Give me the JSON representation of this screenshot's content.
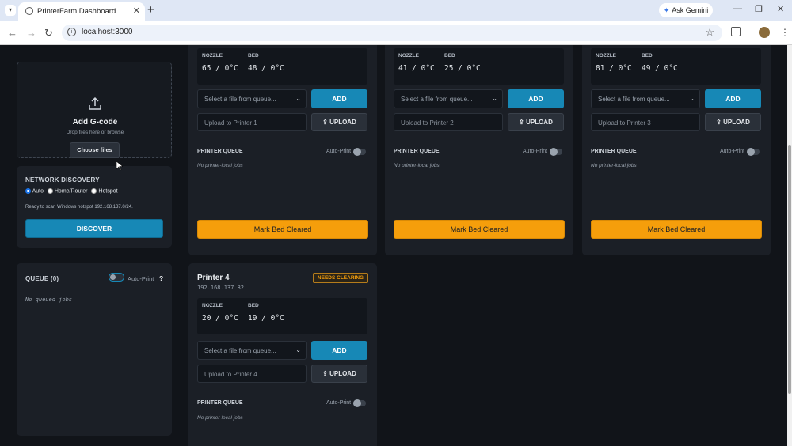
{
  "browser": {
    "tab_title": "PrinterFarm Dashboard",
    "url": "localhost:3000",
    "gemini_label": "Ask Gemini"
  },
  "upload_panel": {
    "title": "Add G-code",
    "hint": "Drop files here or browse",
    "choose_label": "Choose files"
  },
  "network": {
    "title": "NETWORK DISCOVERY",
    "options": [
      "Auto",
      "Home/Router",
      "Hotspot"
    ],
    "selected": "Auto",
    "status": "Ready to scan Windows hotspot 192.168.137.0/24.",
    "discover_label": "DISCOVER"
  },
  "queue": {
    "title": "QUEUE (0)",
    "autoprint_label": "Auto-Print",
    "help": "?",
    "empty": "No queued jobs"
  },
  "labels": {
    "nozzle": "NOZZLE",
    "bed": "BED",
    "select_placeholder": "Select a file from queue...",
    "add": "ADD",
    "upload": "UPLOAD",
    "printer_queue": "PRINTER QUEUE",
    "auto_print": "Auto-Print",
    "no_jobs": "No printer-local jobs",
    "mark_cleared": "Mark Bed Cleared"
  },
  "printers": [
    {
      "upload_placeholder": "Upload to Printer 1",
      "nozzle": "65 / 0°C",
      "bed": "48 / 0°C"
    },
    {
      "upload_placeholder": "Upload to Printer 2",
      "nozzle": "41 / 0°C",
      "bed": "25 / 0°C"
    },
    {
      "upload_placeholder": "Upload to Printer 3",
      "nozzle": "81 / 0°C",
      "bed": "49 / 0°C"
    },
    {
      "name": "Printer 4",
      "ip": "192.168.137.82",
      "status": "NEEDS CLEARING",
      "upload_placeholder": "Upload to Printer 4",
      "nozzle": "20 / 0°C",
      "bed": "19 / 0°C"
    }
  ],
  "colors": {
    "accent_blue": "#1788b6",
    "warning_orange": "#f59e0b",
    "background": "#111419",
    "panel": "#1b1f26"
  }
}
